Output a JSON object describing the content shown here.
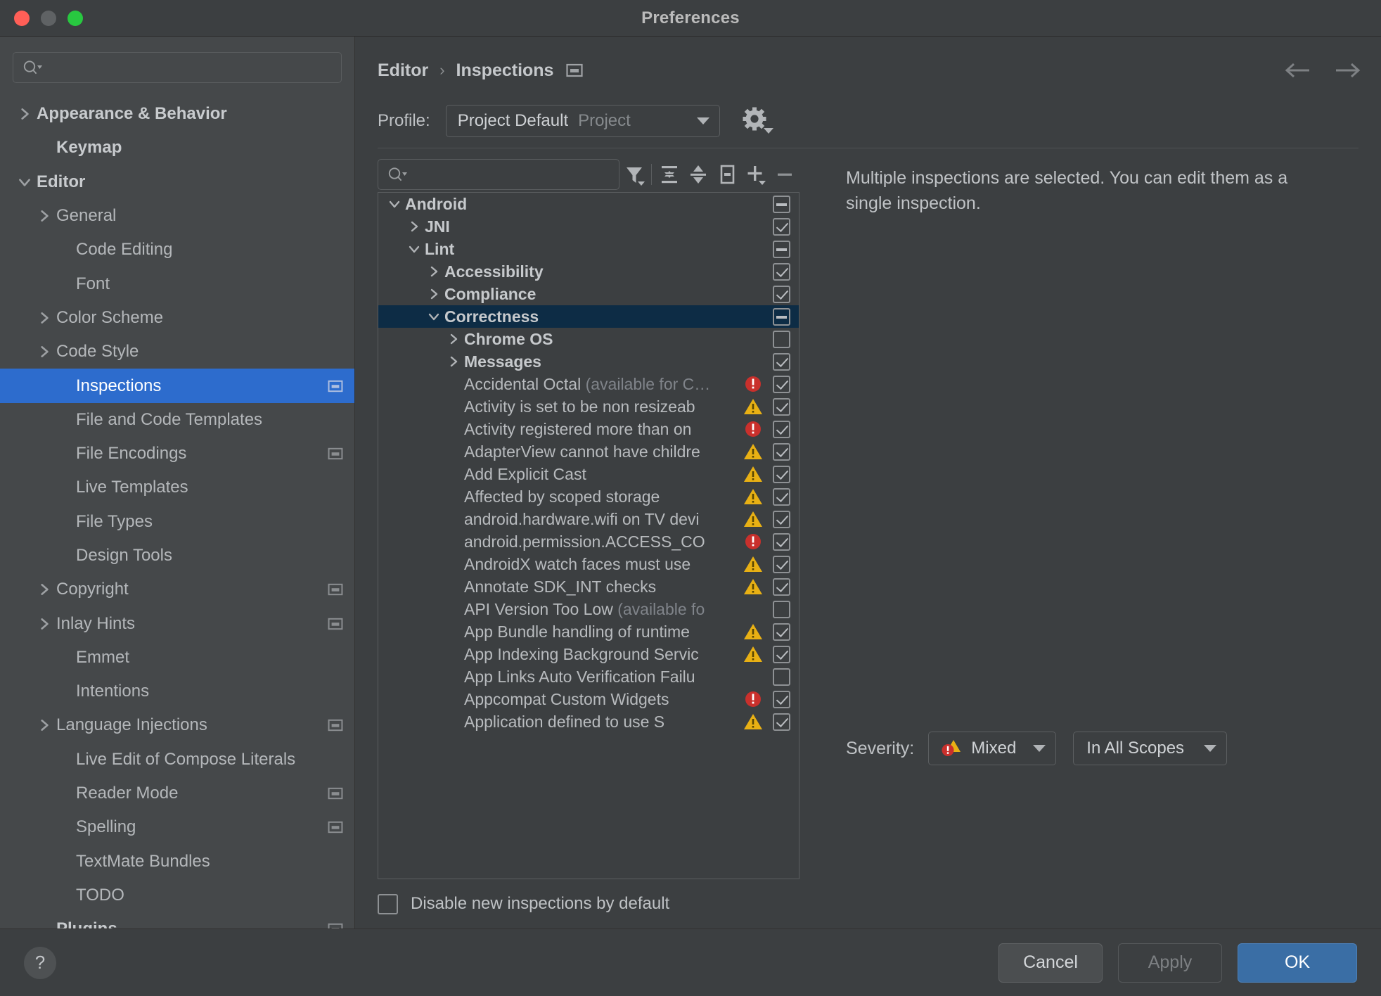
{
  "window": {
    "title": "Preferences"
  },
  "sidebar": {
    "search_placeholder": "",
    "items": [
      {
        "label": "Appearance & Behavior",
        "arrow": "right",
        "bold": true,
        "indent": 0,
        "badge": false,
        "selected": false
      },
      {
        "label": "Keymap",
        "arrow": "none",
        "bold": true,
        "indent": 1,
        "badge": false,
        "selected": false
      },
      {
        "label": "Editor",
        "arrow": "down",
        "bold": true,
        "indent": 0,
        "badge": false,
        "selected": false
      },
      {
        "label": "General",
        "arrow": "right",
        "bold": false,
        "indent": 1,
        "badge": false,
        "selected": false
      },
      {
        "label": "Code Editing",
        "arrow": "none",
        "bold": false,
        "indent": 2,
        "badge": false,
        "selected": false
      },
      {
        "label": "Font",
        "arrow": "none",
        "bold": false,
        "indent": 2,
        "badge": false,
        "selected": false
      },
      {
        "label": "Color Scheme",
        "arrow": "right",
        "bold": false,
        "indent": 1,
        "badge": false,
        "selected": false
      },
      {
        "label": "Code Style",
        "arrow": "right",
        "bold": false,
        "indent": 1,
        "badge": false,
        "selected": false
      },
      {
        "label": "Inspections",
        "arrow": "none",
        "bold": false,
        "indent": 2,
        "badge": true,
        "selected": true
      },
      {
        "label": "File and Code Templates",
        "arrow": "none",
        "bold": false,
        "indent": 2,
        "badge": false,
        "selected": false
      },
      {
        "label": "File Encodings",
        "arrow": "none",
        "bold": false,
        "indent": 2,
        "badge": true,
        "selected": false
      },
      {
        "label": "Live Templates",
        "arrow": "none",
        "bold": false,
        "indent": 2,
        "badge": false,
        "selected": false
      },
      {
        "label": "File Types",
        "arrow": "none",
        "bold": false,
        "indent": 2,
        "badge": false,
        "selected": false
      },
      {
        "label": "Design Tools",
        "arrow": "none",
        "bold": false,
        "indent": 2,
        "badge": false,
        "selected": false
      },
      {
        "label": "Copyright",
        "arrow": "right",
        "bold": false,
        "indent": 1,
        "badge": true,
        "selected": false
      },
      {
        "label": "Inlay Hints",
        "arrow": "right",
        "bold": false,
        "indent": 1,
        "badge": true,
        "selected": false
      },
      {
        "label": "Emmet",
        "arrow": "none",
        "bold": false,
        "indent": 2,
        "badge": false,
        "selected": false
      },
      {
        "label": "Intentions",
        "arrow": "none",
        "bold": false,
        "indent": 2,
        "badge": false,
        "selected": false
      },
      {
        "label": "Language Injections",
        "arrow": "right",
        "bold": false,
        "indent": 1,
        "badge": true,
        "selected": false
      },
      {
        "label": "Live Edit of Compose Literals",
        "arrow": "none",
        "bold": false,
        "indent": 2,
        "badge": false,
        "selected": false
      },
      {
        "label": "Reader Mode",
        "arrow": "none",
        "bold": false,
        "indent": 2,
        "badge": true,
        "selected": false
      },
      {
        "label": "Spelling",
        "arrow": "none",
        "bold": false,
        "indent": 2,
        "badge": true,
        "selected": false
      },
      {
        "label": "TextMate Bundles",
        "arrow": "none",
        "bold": false,
        "indent": 2,
        "badge": false,
        "selected": false
      },
      {
        "label": "TODO",
        "arrow": "none",
        "bold": false,
        "indent": 2,
        "badge": false,
        "selected": false
      },
      {
        "label": "Plugins",
        "arrow": "none",
        "bold": true,
        "indent": 1,
        "badge": true,
        "selected": false
      }
    ]
  },
  "breadcrumb": {
    "parent": "Editor",
    "separator": "›",
    "current": "Inspections"
  },
  "profile": {
    "label": "Profile:",
    "name": "Project Default",
    "kind": "Project",
    "gear_icon": "gear-icon"
  },
  "toolbar": {
    "search_placeholder": "",
    "buttons": [
      {
        "name": "filter-icon",
        "tooltip": "Filter inspections"
      },
      {
        "name": "expand-all-icon",
        "tooltip": "Expand All"
      },
      {
        "name": "collapse-all-icon",
        "tooltip": "Collapse All"
      },
      {
        "name": "reset-icon",
        "tooltip": "Reset to Defaults"
      },
      {
        "name": "add-icon",
        "tooltip": "Add"
      },
      {
        "name": "remove-icon",
        "tooltip": "Remove"
      }
    ]
  },
  "tree": {
    "rows": [
      {
        "label": "Android",
        "suffix": "",
        "indent": 0,
        "arrow": "down",
        "group": true,
        "check": "partial",
        "severity": "none",
        "selected": false
      },
      {
        "label": "JNI",
        "suffix": "",
        "indent": 1,
        "arrow": "right",
        "group": true,
        "check": "checked",
        "severity": "none",
        "selected": false
      },
      {
        "label": "Lint",
        "suffix": "",
        "indent": 1,
        "arrow": "down",
        "group": true,
        "check": "partial",
        "severity": "none",
        "selected": false
      },
      {
        "label": "Accessibility",
        "suffix": "",
        "indent": 2,
        "arrow": "right",
        "group": true,
        "check": "checked",
        "severity": "none",
        "selected": false
      },
      {
        "label": "Compliance",
        "suffix": "",
        "indent": 2,
        "arrow": "right",
        "group": true,
        "check": "checked",
        "severity": "none",
        "selected": false
      },
      {
        "label": "Correctness",
        "suffix": "",
        "indent": 2,
        "arrow": "down",
        "group": true,
        "check": "partial",
        "severity": "none",
        "selected": true
      },
      {
        "label": "Chrome OS",
        "suffix": "",
        "indent": 3,
        "arrow": "right",
        "group": true,
        "check": "unchecked",
        "severity": "none",
        "selected": false
      },
      {
        "label": "Messages",
        "suffix": "",
        "indent": 3,
        "arrow": "right",
        "group": true,
        "check": "checked",
        "severity": "none",
        "selected": false
      },
      {
        "label": "Accidental Octal",
        "suffix": "(available for C…",
        "indent": 3,
        "arrow": "none",
        "group": false,
        "check": "checked",
        "severity": "error",
        "selected": false
      },
      {
        "label": "Activity is set to be non resizeab",
        "suffix": "",
        "indent": 3,
        "arrow": "none",
        "group": false,
        "check": "checked",
        "severity": "warning",
        "selected": false
      },
      {
        "label": "Activity registered more than on",
        "suffix": "",
        "indent": 3,
        "arrow": "none",
        "group": false,
        "check": "checked",
        "severity": "error",
        "selected": false
      },
      {
        "label": "AdapterView cannot have childre",
        "suffix": "",
        "indent": 3,
        "arrow": "none",
        "group": false,
        "check": "checked",
        "severity": "warning",
        "selected": false
      },
      {
        "label": "Add Explicit Cast",
        "suffix": "",
        "indent": 3,
        "arrow": "none",
        "group": false,
        "check": "checked",
        "severity": "warning",
        "selected": false
      },
      {
        "label": "Affected by scoped storage",
        "suffix": "",
        "indent": 3,
        "arrow": "none",
        "group": false,
        "check": "checked",
        "severity": "warning",
        "selected": false
      },
      {
        "label": "android.hardware.wifi on TV devi",
        "suffix": "",
        "indent": 3,
        "arrow": "none",
        "group": false,
        "check": "checked",
        "severity": "warning",
        "selected": false
      },
      {
        "label": "android.permission.ACCESS_CO",
        "suffix": "",
        "indent": 3,
        "arrow": "none",
        "group": false,
        "check": "checked",
        "severity": "error",
        "selected": false
      },
      {
        "label": "AndroidX watch faces must use ",
        "suffix": "",
        "indent": 3,
        "arrow": "none",
        "group": false,
        "check": "checked",
        "severity": "warning",
        "selected": false
      },
      {
        "label": "Annotate SDK_INT checks",
        "suffix": "",
        "indent": 3,
        "arrow": "none",
        "group": false,
        "check": "checked",
        "severity": "warning",
        "selected": false
      },
      {
        "label": "API Version Too Low",
        "suffix": "(available fo",
        "indent": 3,
        "arrow": "none",
        "group": false,
        "check": "unchecked",
        "severity": "none",
        "selected": false
      },
      {
        "label": "App Bundle handling of runtime ",
        "suffix": "",
        "indent": 3,
        "arrow": "none",
        "group": false,
        "check": "checked",
        "severity": "warning",
        "selected": false
      },
      {
        "label": "App Indexing Background Servic",
        "suffix": "",
        "indent": 3,
        "arrow": "none",
        "group": false,
        "check": "checked",
        "severity": "warning",
        "selected": false
      },
      {
        "label": "App Links Auto Verification Failu",
        "suffix": "",
        "indent": 3,
        "arrow": "none",
        "group": false,
        "check": "unchecked",
        "severity": "none",
        "selected": false
      },
      {
        "label": "Appcompat Custom Widgets",
        "suffix": "",
        "indent": 3,
        "arrow": "none",
        "group": false,
        "check": "checked",
        "severity": "error",
        "selected": false
      },
      {
        "label": "Application defined to use S",
        "suffix": "",
        "indent": 3,
        "arrow": "none",
        "group": false,
        "check": "checked",
        "severity": "warning",
        "selected": false
      }
    ]
  },
  "disable_new": {
    "label": "Disable new inspections by default",
    "checked": false
  },
  "detail": {
    "message": "Multiple inspections are selected. You can edit them as a single inspection.",
    "severity_label": "Severity:",
    "severity_value": "Mixed",
    "scope_value": "In All Scopes"
  },
  "footer": {
    "help_glyph": "?",
    "cancel": "Cancel",
    "apply": "Apply",
    "ok": "OK"
  },
  "colors": {
    "accent": "#2d6ccd",
    "selection_tree": "#0d2c45",
    "ok_button": "#3a6ea5",
    "error": "#c9302c",
    "warning": "#e8b014",
    "window_bg": "#3c3f41",
    "sidebar_bg": "#45484a"
  }
}
